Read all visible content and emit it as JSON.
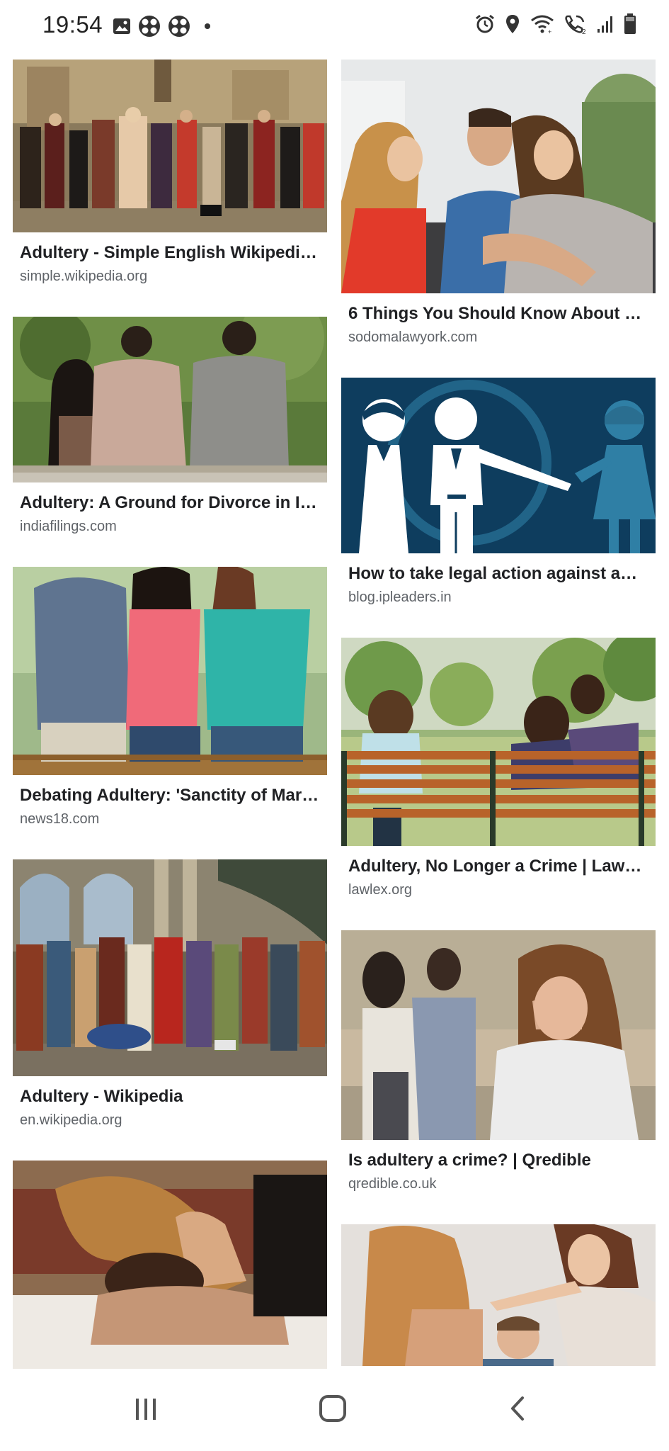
{
  "status_bar": {
    "time": "19:54",
    "left_icons": [
      "gallery-icon",
      "game-launcher-icon",
      "game-launcher-icon",
      "notification-dot-icon"
    ],
    "right_icons": [
      "alarm-icon",
      "location-icon",
      "wifi-calling-icon",
      "volte-icon",
      "signal-icon",
      "battery-icon"
    ]
  },
  "results": {
    "left": [
      {
        "title": "Adultery - Simple English Wikipedi…",
        "source": "simple.wikipedia.org",
        "image": "renaissance-crowd-painting"
      },
      {
        "title": "Adultery: A Ground for Divorce in I…",
        "source": "indiafilings.com",
        "image": "couples-sitting-holding-hands-behind-backs"
      },
      {
        "title": "Debating Adultery: 'Sanctity of Mar…",
        "source": "news18.com",
        "image": "three-people-on-bench-holding-hands"
      },
      {
        "title": "Adultery - Wikipedia",
        "source": "en.wikipedia.org",
        "image": "classical-painting-crowd-in-colonnade"
      },
      {
        "title": "",
        "source": "",
        "image": "couple-in-bed"
      }
    ],
    "right": [
      {
        "title": "6 Things You Should Know About …",
        "source": "sodomalawyork.com",
        "image": "man-kissing-two-women"
      },
      {
        "title": "How to take legal action against a…",
        "source": "blog.ipleaders.in",
        "image": "bride-groom-other-woman-illustration"
      },
      {
        "title": "Adultery, No Longer a Crime | Law…",
        "source": "lawlex.org",
        "image": "three-people-on-park-bench"
      },
      {
        "title": "Is adultery a crime? | Qredible",
        "source": "qredible.co.uk",
        "image": "woman-upset-couple-in-background"
      },
      {
        "title": "",
        "source": "",
        "image": "woman-confronting-couple"
      }
    ]
  },
  "colors": {
    "illustration_bg": "#0e3d5e",
    "illustration_figure": "#ffffff",
    "illustration_accent": "#2f7fa5"
  },
  "nav_bar": {
    "icons": [
      "recent-apps-icon",
      "home-icon",
      "back-icon"
    ]
  }
}
